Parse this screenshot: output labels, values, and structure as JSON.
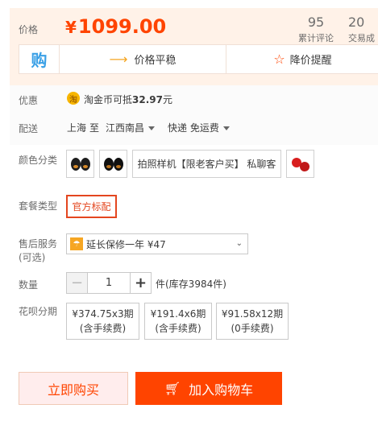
{
  "price": {
    "label": "价格",
    "currency": "¥",
    "value": "1099.00",
    "review_count": "95",
    "review_label": "累计评论",
    "trade_count": "20",
    "trade_label": "交易成"
  },
  "tools": {
    "buy_icon": "购",
    "trend_label": "价格平稳",
    "remind_label": "降价提醒"
  },
  "promo": {
    "label": "优惠",
    "coin_icon": "淘",
    "text_prefix": "淘金币可抵",
    "amount": "32.97",
    "text_suffix": "元"
  },
  "shipping": {
    "label": "配送",
    "from": "上海",
    "to_word": "至",
    "destination": "江西南昌",
    "method": "快递 免运费"
  },
  "color": {
    "label": "颜色分类",
    "option_text": "拍照样机【限老客户买】 私聊客"
  },
  "package": {
    "label": "套餐类型",
    "selected": "官方标配"
  },
  "service": {
    "label": "售后服务",
    "sub_label": "(可选)",
    "option": "延长保修一年 ¥47"
  },
  "quantity": {
    "label": "数量",
    "minus": "−",
    "value": "1",
    "plus": "+",
    "stock_text": "件(库存3984件)"
  },
  "installment": {
    "label": "花呗分期",
    "options": [
      {
        "price": "¥374.75x3期",
        "fee": "(含手续费)"
      },
      {
        "price": "¥191.4x6期",
        "fee": "(含手续费)"
      },
      {
        "price": "¥91.58x12期",
        "fee": "(0手续费)"
      }
    ]
  },
  "actions": {
    "buy_now": "立即购买",
    "add_cart": "加入购物车"
  },
  "colors": {
    "accent": "#ff4400",
    "price_bg": "#fff2e8",
    "selected_border": "#e4461f"
  }
}
